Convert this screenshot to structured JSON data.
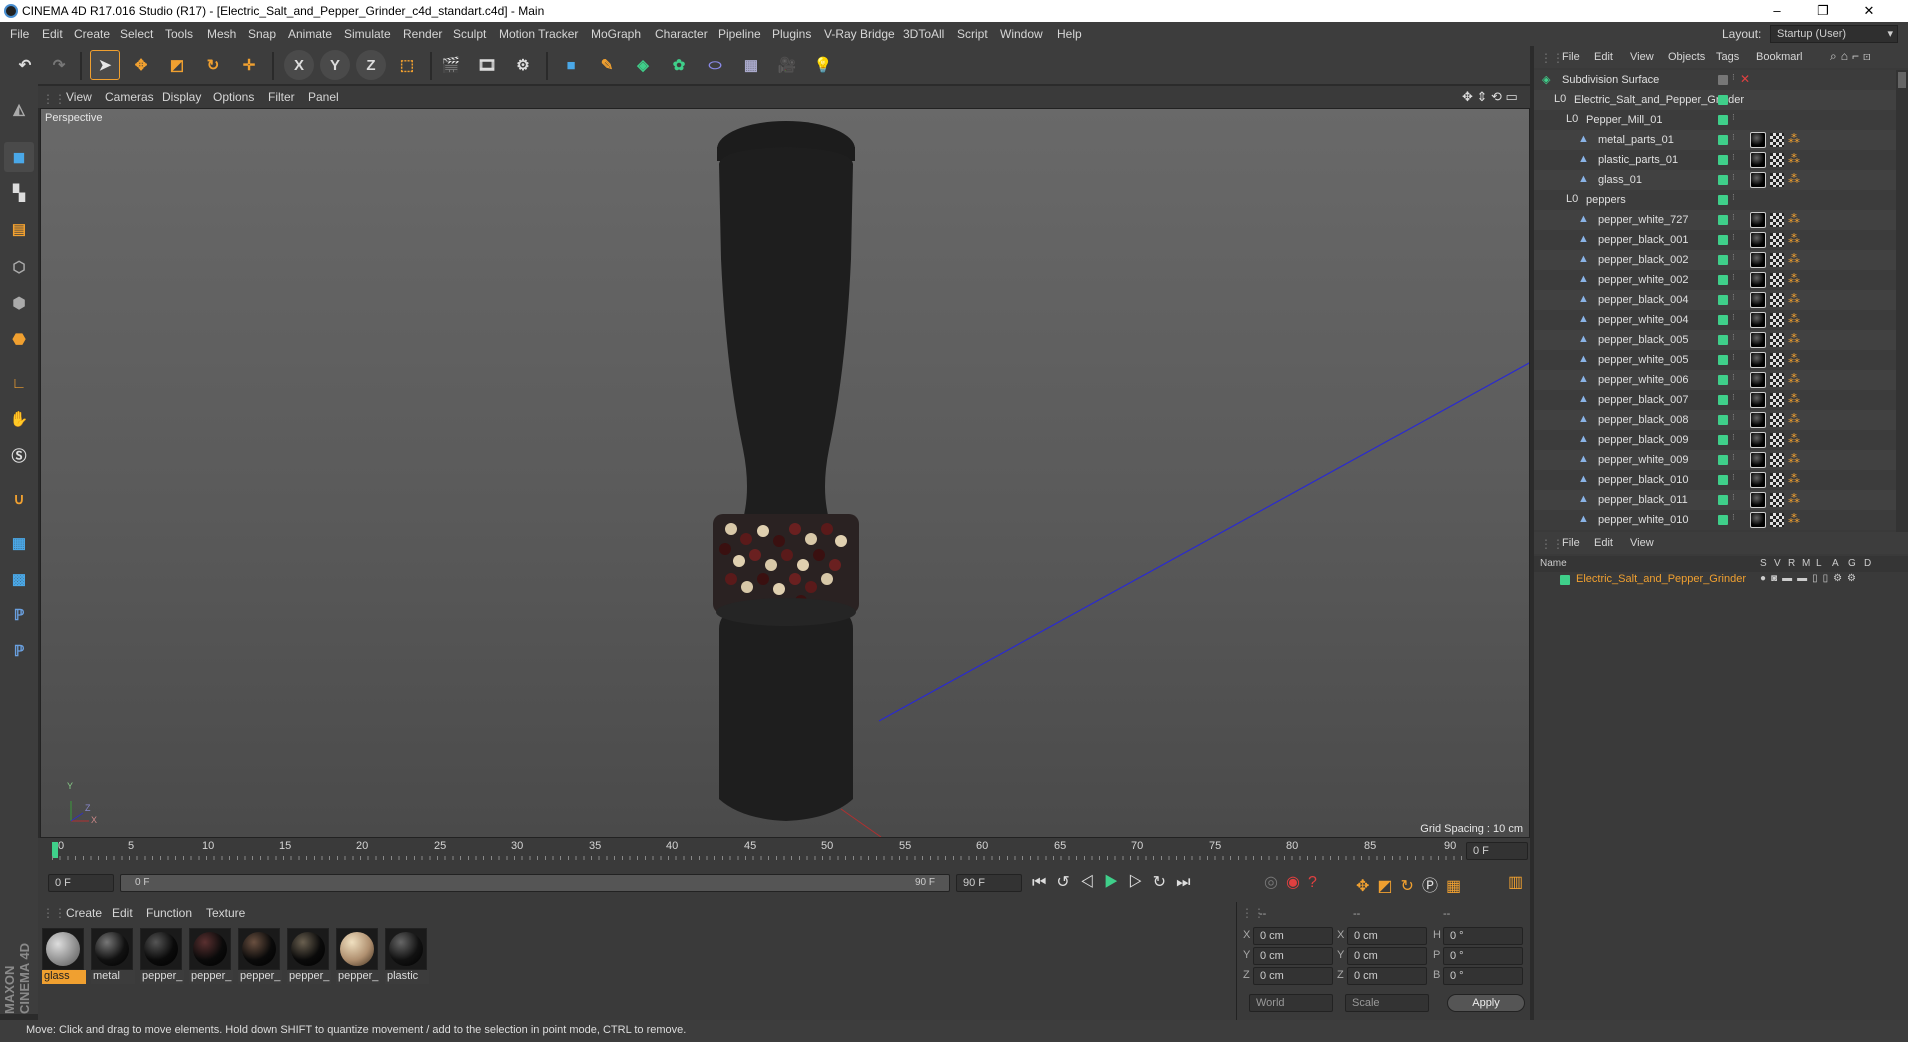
{
  "window": {
    "title": "CINEMA 4D R17.016 Studio (R17) - [Electric_Salt_and_Pepper_Grinder_c4d_standart.c4d] - Main"
  },
  "menubar": {
    "items": [
      "File",
      "Edit",
      "Create",
      "Select",
      "Tools",
      "Mesh",
      "Snap",
      "Animate",
      "Simulate",
      "Render",
      "Sculpt",
      "Motion Tracker",
      "MoGraph",
      "Character",
      "Pipeline",
      "Plugins",
      "V-Ray Bridge",
      "3DToAll",
      "Script",
      "Window",
      "Help"
    ],
    "layout_label": "Layout:",
    "layout_value": "Startup (User)"
  },
  "toolbar": {
    "icons": [
      "undo-icon",
      "redo-icon",
      "select-arrow-icon",
      "move-icon",
      "scale-icon",
      "rotate-icon",
      "move-add-icon",
      "x-axis-icon",
      "y-axis-icon",
      "z-axis-icon",
      "coordinate-system-icon",
      "render-view-icon",
      "render-picture-icon",
      "render-settings-icon",
      "cube-icon",
      "pen-icon",
      "subdivision-icon",
      "cloner-icon",
      "deformer-icon",
      "floor-icon",
      "camera-icon",
      "light-icon"
    ],
    "x_label": "X",
    "y_label": "Y",
    "z_label": "Z"
  },
  "viewport": {
    "menu": [
      "View",
      "Cameras",
      "Display",
      "Options",
      "Filter",
      "Panel"
    ],
    "label": "Perspective",
    "grid_spacing": "Grid Spacing : 10 cm",
    "axis_y": "Y",
    "axis_x": "X",
    "axis_z": "Z"
  },
  "timeline": {
    "ticks": [
      "0",
      "5",
      "10",
      "15",
      "20",
      "25",
      "30",
      "35",
      "40",
      "45",
      "50",
      "55",
      "60",
      "65",
      "70",
      "75",
      "80",
      "85",
      "90"
    ],
    "current_frame_field": "0 F",
    "start_field": "0 F",
    "range_start": "0 F",
    "range_end": "90 F",
    "end_field": "90 F"
  },
  "material_manager": {
    "menu": [
      "Create",
      "Edit",
      "Function",
      "Texture"
    ],
    "materials": [
      {
        "name": "glass",
        "selected": true
      },
      {
        "name": "metal"
      },
      {
        "name": "pepper_"
      },
      {
        "name": "pepper_"
      },
      {
        "name": "pepper_"
      },
      {
        "name": "pepper_"
      },
      {
        "name": "pepper_"
      },
      {
        "name": "plastic"
      }
    ]
  },
  "coordinates": {
    "headers": [
      "--",
      "--",
      "--"
    ],
    "rows": [
      {
        "a": "X",
        "av": "0 cm",
        "b": "X",
        "bv": "0 cm",
        "c": "H",
        "cv": "0 °"
      },
      {
        "a": "Y",
        "av": "0 cm",
        "b": "Y",
        "bv": "0 cm",
        "c": "P",
        "cv": "0 °"
      },
      {
        "a": "Z",
        "av": "0 cm",
        "b": "Z",
        "bv": "0 cm",
        "c": "B",
        "cv": "0 °"
      }
    ],
    "mode1": "World",
    "mode2": "Scale",
    "apply": "Apply"
  },
  "object_manager": {
    "menu": [
      "File",
      "Edit",
      "View",
      "Objects",
      "Tags",
      "Bookmarl"
    ],
    "objects": [
      {
        "name": "Subdivision Surface",
        "level": 0
      },
      {
        "name": "Electric_Salt_and_Pepper_Grinder",
        "level": 1
      },
      {
        "name": "Pepper_Mill_01",
        "level": 2
      },
      {
        "name": "metal_parts_01",
        "level": 3
      },
      {
        "name": "plastic_parts_01",
        "level": 3
      },
      {
        "name": "glass_01",
        "level": 3
      },
      {
        "name": "peppers",
        "level": 2
      },
      {
        "name": "pepper_white_727",
        "level": 3
      },
      {
        "name": "pepper_black_001",
        "level": 3
      },
      {
        "name": "pepper_black_002",
        "level": 3
      },
      {
        "name": "pepper_white_002",
        "level": 3
      },
      {
        "name": "pepper_black_004",
        "level": 3
      },
      {
        "name": "pepper_white_004",
        "level": 3
      },
      {
        "name": "pepper_black_005",
        "level": 3
      },
      {
        "name": "pepper_white_005",
        "level": 3
      },
      {
        "name": "pepper_white_006",
        "level": 3
      },
      {
        "name": "pepper_black_007",
        "level": 3
      },
      {
        "name": "pepper_black_008",
        "level": 3
      },
      {
        "name": "pepper_black_009",
        "level": 3
      },
      {
        "name": "pepper_white_009",
        "level": 3
      },
      {
        "name": "pepper_black_010",
        "level": 3
      },
      {
        "name": "pepper_black_011",
        "level": 3
      },
      {
        "name": "pepper_white_010",
        "level": 3
      }
    ]
  },
  "attribute_manager": {
    "menu": [
      "File",
      "Edit",
      "View"
    ],
    "columns": [
      "Name",
      "S",
      "V",
      "R",
      "M",
      "L",
      "A",
      "G",
      "D"
    ],
    "layer_name": "Electric_Salt_and_Pepper_Grinder"
  },
  "status": {
    "text": "Move: Click and drag to move elements. Hold down SHIFT to quantize movement / add to the selection in point mode, CTRL to remove."
  },
  "branding": {
    "logo_text": "MAXON CINEMA 4D"
  },
  "colors": {
    "accent_orange": "#f0a030",
    "object_green": "#3fcf8a",
    "axis_blue": "#2a2ad0"
  }
}
